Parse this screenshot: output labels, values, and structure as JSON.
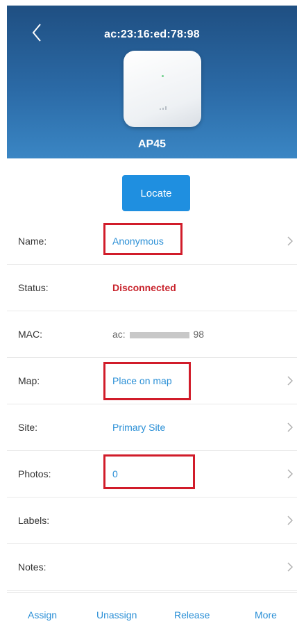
{
  "header": {
    "title": "ac:23:16:ed:78:98",
    "device_name": "AP45",
    "back_icon": "chevron-left-icon"
  },
  "locate_label": "Locate",
  "details": [
    {
      "label": "Name:",
      "value": "Anonymous",
      "style": "link",
      "chevron": true
    },
    {
      "label": "Status:",
      "value": "Disconnected",
      "style": "error",
      "chevron": false
    },
    {
      "label": "MAC:",
      "value_prefix": "ac:",
      "value_suffix": "98",
      "style": "muted",
      "chevron": false
    },
    {
      "label": "Map:",
      "value": "Place on map",
      "style": "link",
      "chevron": true
    },
    {
      "label": "Site:",
      "value": "Primary Site",
      "style": "link",
      "chevron": true
    },
    {
      "label": "Photos:",
      "value": "0",
      "style": "link",
      "chevron": true
    },
    {
      "label": "Labels:",
      "value": "",
      "chevron": true
    },
    {
      "label": "Notes:",
      "value": "",
      "chevron": true
    }
  ],
  "actions": {
    "assign": "Assign",
    "unassign": "Unassign",
    "release": "Release",
    "more": "More"
  },
  "colors": {
    "header_bg": "#2b6aa6",
    "accent": "#1f8fe0",
    "link": "#2a8fd6",
    "error": "#c8232c",
    "highlight": "#d11c2a"
  }
}
